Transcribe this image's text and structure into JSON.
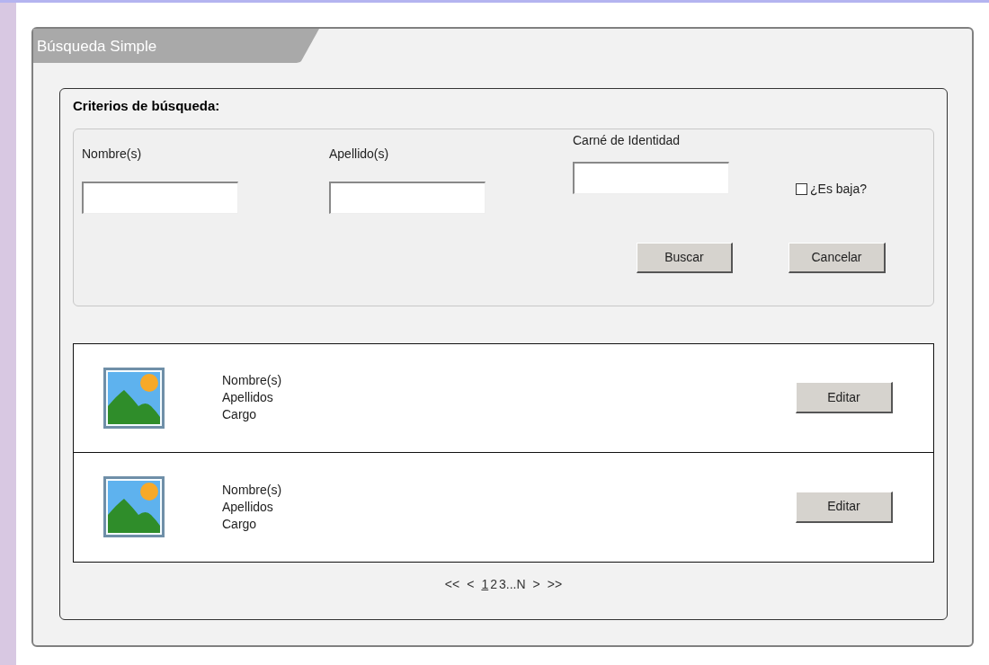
{
  "panel": {
    "title": "Búsqueda Simple"
  },
  "criteria": {
    "legend": "Criterios de búsqueda:",
    "fields": [
      {
        "label": "Nombre(s)"
      },
      {
        "label": "Apellido(s)"
      },
      {
        "label": "Carné de Identidad"
      }
    ],
    "checkbox": {
      "label": "¿Es baja?",
      "checked": false
    },
    "buttons": [
      "Buscar",
      "Cancelar"
    ]
  },
  "results": [
    {
      "lines": [
        "Nombre(s)",
        "Apellidos",
        "Cargo"
      ],
      "button": "Editar"
    },
    {
      "lines": [
        "Nombre(s)",
        "Apellidos",
        "Cargo"
      ],
      "button": "Editar"
    }
  ],
  "pagination": {
    "first": "<<",
    "prev": "<",
    "pages": [
      {
        "label": "1",
        "selected": true
      },
      {
        "label": "2",
        "selected": false
      },
      {
        "label": "3...N",
        "selected": false
      }
    ],
    "next": ">",
    "last": ">>"
  }
}
